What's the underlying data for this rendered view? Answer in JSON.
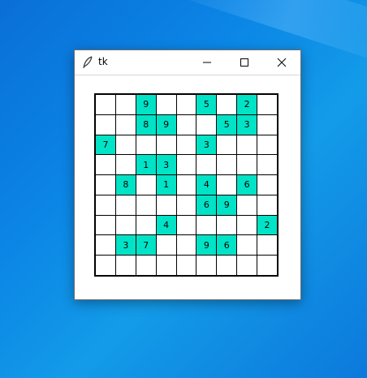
{
  "window": {
    "title": "tk"
  },
  "sudoku": {
    "rows": [
      [
        "",
        "",
        "9",
        "",
        "",
        "5",
        "",
        "2",
        ""
      ],
      [
        "",
        "",
        "8",
        "9",
        "",
        "",
        "5",
        "3",
        ""
      ],
      [
        "7",
        "",
        "",
        "",
        "",
        "3",
        "",
        "",
        ""
      ],
      [
        "",
        "",
        "1",
        "3",
        "",
        "",
        "",
        "",
        ""
      ],
      [
        "",
        "8",
        "",
        "1",
        "",
        "4",
        "",
        "6",
        ""
      ],
      [
        "",
        "",
        "",
        "",
        "",
        "6",
        "9",
        "",
        ""
      ],
      [
        "",
        "",
        "",
        "4",
        "",
        "",
        "",
        "",
        "2"
      ],
      [
        "",
        "3",
        "7",
        "",
        "",
        "9",
        "6",
        "",
        ""
      ],
      [
        "",
        "",
        "",
        "",
        "",
        "",
        "",
        "",
        ""
      ]
    ],
    "given_color": "#00e3c6"
  },
  "icons": {
    "app": "feather-icon",
    "minimize": "minimize-icon",
    "maximize": "maximize-icon",
    "close": "close-icon"
  }
}
